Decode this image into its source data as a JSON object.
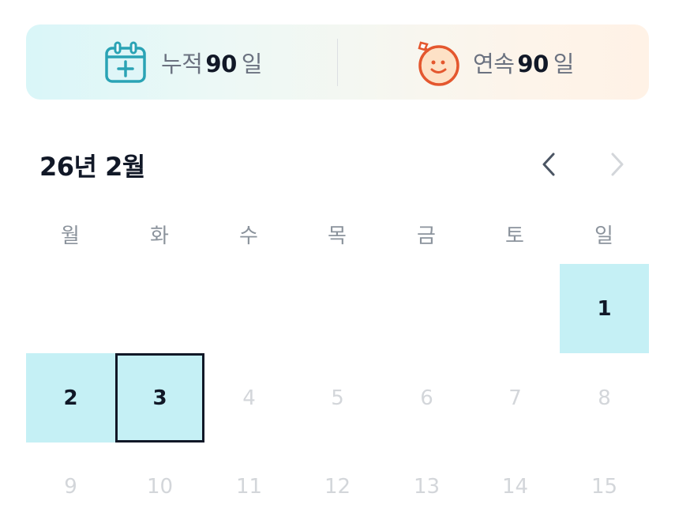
{
  "stats": {
    "cumulative": {
      "label": "누적",
      "value": "90",
      "unit": "일",
      "icon": "calendar-plus-icon"
    },
    "streak": {
      "label": "연속",
      "value": "90",
      "unit": "일",
      "icon": "smiley-face-icon"
    }
  },
  "calendar": {
    "title": "26년 2월",
    "prev_icon": "chevron-left-icon",
    "next_icon": "chevron-right-icon",
    "weekdays": [
      "월",
      "화",
      "수",
      "목",
      "금",
      "토",
      "일"
    ],
    "days": {
      "d1": "1",
      "d2": "2",
      "d3": "3",
      "d4": "4",
      "d5": "5",
      "d6": "6",
      "d7": "7",
      "d8": "8",
      "d9": "9",
      "d10": "10",
      "d11": "11",
      "d12": "12",
      "d13": "13",
      "d14": "14",
      "d15": "15"
    }
  },
  "colors": {
    "completed_day": "#c5f0f5",
    "today_border": "#111827",
    "calendar_icon": "#2aa3b5",
    "smiley_icon": "#e4572e",
    "smiley_fill": "#fde1c6"
  }
}
